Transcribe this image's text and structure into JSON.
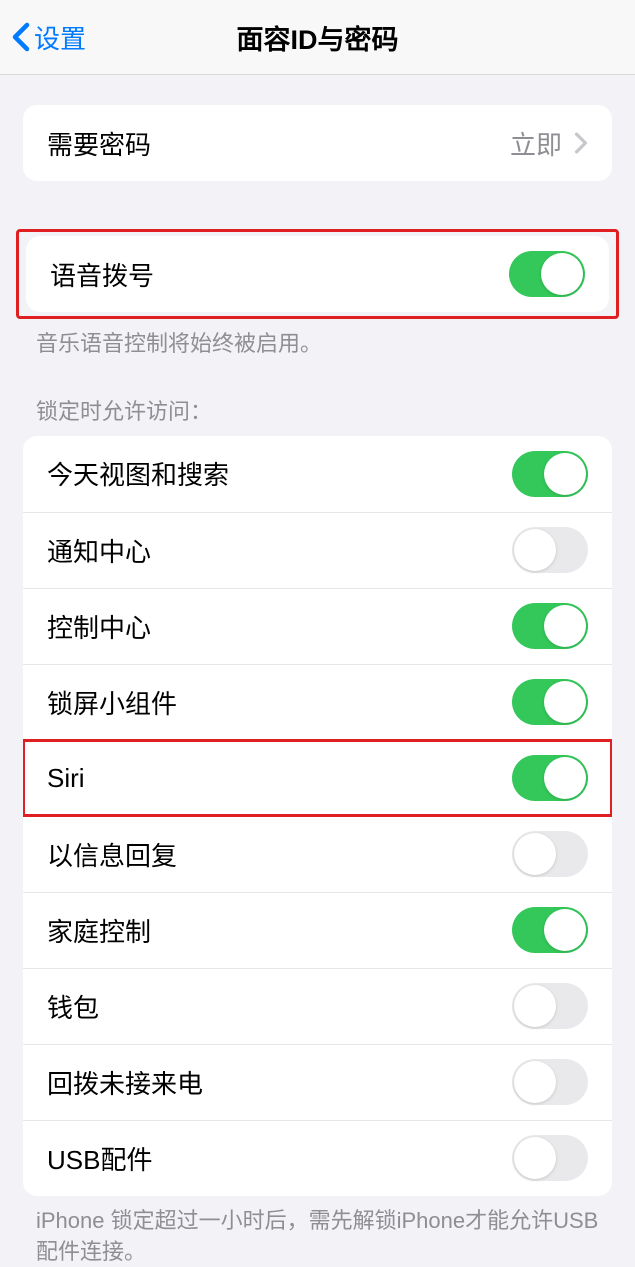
{
  "nav": {
    "back": "设置",
    "title": "面容ID与密码"
  },
  "requirePasscode": {
    "label": "需要密码",
    "value": "立即"
  },
  "voiceDial": {
    "label": "语音拨号",
    "on": true,
    "footer": "音乐语音控制将始终被启用。"
  },
  "lockedAccess": {
    "header": "锁定时允许访问：",
    "items": [
      {
        "label": "今天视图和搜索",
        "on": true
      },
      {
        "label": "通知中心",
        "on": false
      },
      {
        "label": "控制中心",
        "on": true
      },
      {
        "label": "锁屏小组件",
        "on": true
      },
      {
        "label": "Siri",
        "on": true
      },
      {
        "label": "以信息回复",
        "on": false
      },
      {
        "label": "家庭控制",
        "on": true
      },
      {
        "label": "钱包",
        "on": false
      },
      {
        "label": "回拨未接来电",
        "on": false
      },
      {
        "label": "USB配件",
        "on": false
      }
    ],
    "footer": "iPhone 锁定超过一小时后，需先解锁iPhone才能允许USB 配件连接。"
  }
}
